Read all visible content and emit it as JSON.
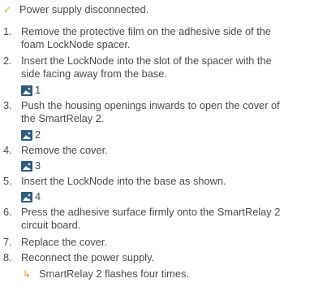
{
  "prerequisite": {
    "icon": "checkmark-icon",
    "icon_color": "#e8a21c",
    "text": "Power supply disconnected."
  },
  "steps": [
    {
      "number": "1.",
      "text": "Remove the protective film on the adhesive side of the\nfoam LockNode spacer."
    },
    {
      "number": "2.",
      "text": "Insert the LockNode into the slot of the spacer with the\nside facing away from the base."
    },
    {
      "number": "3.",
      "text": "Push the housing openings inwards to open the cover of\nthe SmartRelay 2."
    },
    {
      "number": "4.",
      "text": "Remove the cover."
    },
    {
      "number": "5.",
      "text": "Insert the LockNode into the base as shown."
    },
    {
      "number": "6.",
      "text": "Press the adhesive surface firmly onto the SmartRelay 2\ncircuit board."
    },
    {
      "number": "7.",
      "text": "Replace the cover."
    },
    {
      "number": "8.",
      "text": "Reconnect the power supply."
    }
  ],
  "image_refs": [
    {
      "icon": "image-icon",
      "label": "1"
    },
    {
      "icon": "image-icon",
      "label": "2"
    },
    {
      "icon": "image-icon",
      "label": "3"
    },
    {
      "icon": "image-icon",
      "label": "4"
    }
  ],
  "result": {
    "icon": "result-arrow-icon",
    "text": "SmartRelay 2 flashes four times."
  },
  "colors": {
    "accent": "#e8a21c",
    "image_icon": "#2f5c7e",
    "text": "#4a4a4a"
  }
}
